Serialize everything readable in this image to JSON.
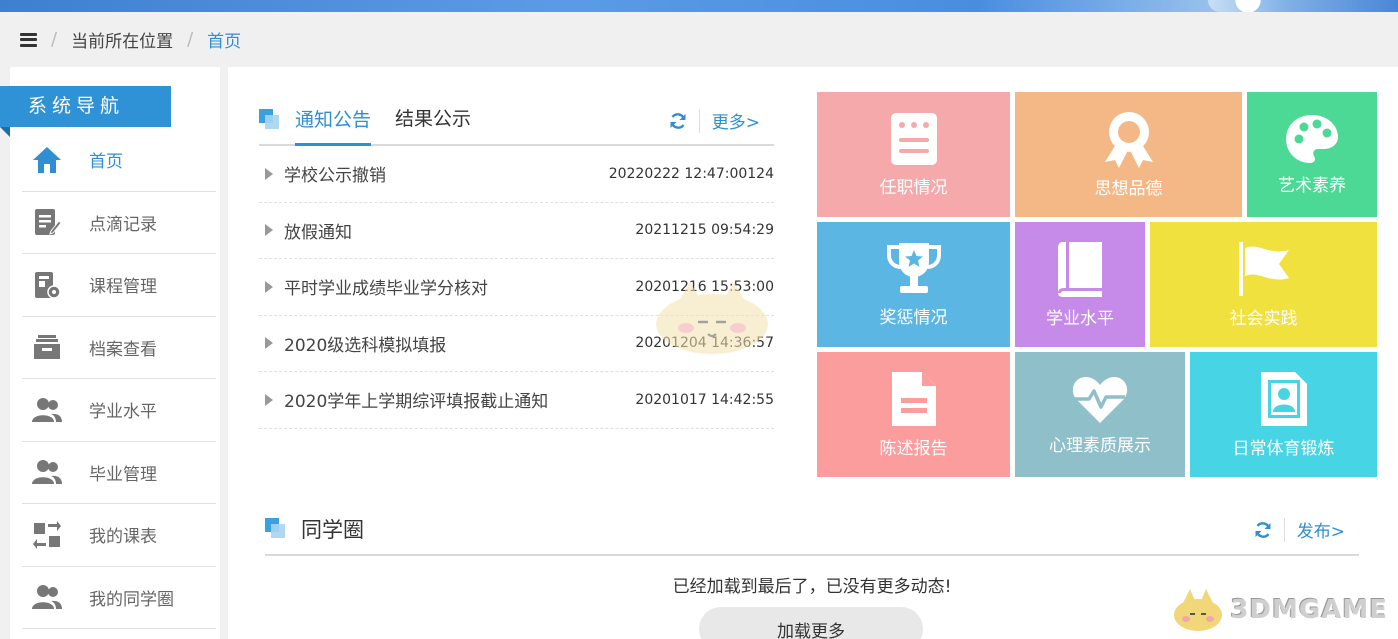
{
  "breadcrumb": {
    "location_label": "当前所在位置",
    "current": "首页"
  },
  "sidebar": {
    "title": "系统导航",
    "items": [
      {
        "label": "首页",
        "icon": "home-icon",
        "active": true
      },
      {
        "label": "点滴记录",
        "icon": "edit-icon"
      },
      {
        "label": "课程管理",
        "icon": "course-settings-icon"
      },
      {
        "label": "档案查看",
        "icon": "archive-box-icon"
      },
      {
        "label": "学业水平",
        "icon": "users-icon"
      },
      {
        "label": "毕业管理",
        "icon": "users-icon"
      },
      {
        "label": "我的课表",
        "icon": "swap-icon"
      },
      {
        "label": "我的同学圈",
        "icon": "users-icon"
      }
    ]
  },
  "notice": {
    "tabs": [
      {
        "label": "通知公告",
        "active": true
      },
      {
        "label": "结果公示"
      }
    ],
    "more_label": "更多>",
    "items": [
      {
        "title": "学校公示撤销",
        "date": "20220222 12:47:00124"
      },
      {
        "title": "放假通知",
        "date": "20211215 09:54:29"
      },
      {
        "title": "平时学业成绩毕业学分核对",
        "date": "20201216 15:53:00"
      },
      {
        "title": "2020级选科模拟填报",
        "date": "20201204 14:36:57"
      },
      {
        "title": "2020学年上学期综评填报截止通知",
        "date": "20201017 14:42:55"
      }
    ]
  },
  "tiles": [
    {
      "label": "任职情况",
      "icon": "document-list-icon",
      "color": "#f5a9ab"
    },
    {
      "label": "思想品德",
      "icon": "medal-icon",
      "color": "#f4b886"
    },
    {
      "label": "艺术素养",
      "icon": "palette-icon",
      "color": "#4cd995"
    },
    {
      "label": "奖惩情况",
      "icon": "trophy-icon",
      "color": "#5cb6e4"
    },
    {
      "label": "学业水平",
      "icon": "book-icon",
      "color": "#c68ae9"
    },
    {
      "label": "社会实践",
      "icon": "flag-icon",
      "color": "#f0e13e"
    },
    {
      "label": "陈述报告",
      "icon": "report-file-icon",
      "color": "#fb9d9d"
    },
    {
      "label": "心理素质展示",
      "icon": "heartbeat-icon",
      "color": "#8fbfc9"
    },
    {
      "label": "日常体育锻炼",
      "icon": "id-card-icon",
      "color": "#47d5e5"
    }
  ],
  "circle": {
    "title": "同学圈",
    "publish_label": "发布>",
    "empty_message": "已经加载到最后了，已没有更多动态!",
    "load_more_label": "加载更多"
  },
  "watermark": {
    "text": "3DMGAME"
  },
  "colors": {
    "accent": "#2f8fd0",
    "nav_title_bg": "#2f92d6"
  }
}
